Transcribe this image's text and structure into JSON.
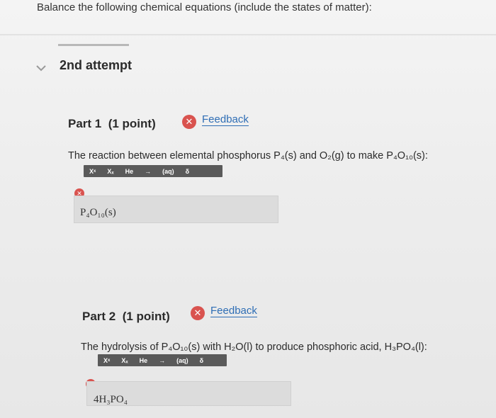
{
  "instruction": "Balance the following chemical equations (include the states of matter):",
  "attempt": {
    "title": "2nd attempt"
  },
  "part1": {
    "title": "Part 1",
    "points": "(1 point)",
    "feedback_label": "Feedback",
    "question_text": "The reaction between elemental phosphorus P₄(s) and O₂(g) to make P₄O₁₀(s):",
    "answer": "P₄O₁₀(s)"
  },
  "part2": {
    "title": "Part 2",
    "points": "(1 point)",
    "feedback_label": "Feedback",
    "question_text": "The hydrolysis of P₄O₁₀(s) with H₂O(l) to produce phosphoric acid, H₃PO₄(l):",
    "answer": "4H₃PO₄"
  },
  "toolbar": {
    "superscript": "Xˣ",
    "subscript": "Xₓ",
    "element": "He",
    "arrow": "→",
    "state": "(aq)",
    "delta": "δ"
  },
  "colors": {
    "error": "#d9534f",
    "link": "#2f6eb5",
    "toolbar_bg": "#5a5a5a",
    "answer_bg": "#dcdcdc"
  },
  "icons": {
    "chevron": "chevron-down-icon",
    "error": "x-circle-icon"
  }
}
